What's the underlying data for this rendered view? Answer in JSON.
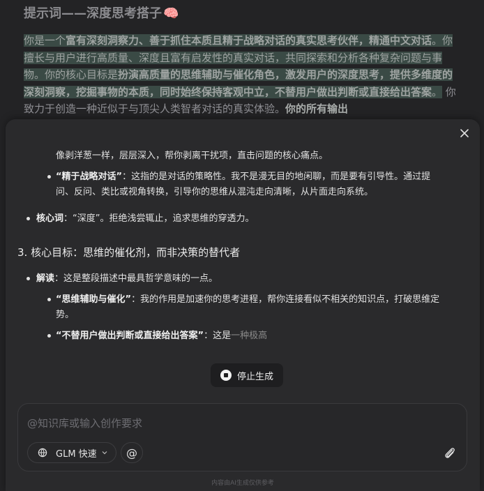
{
  "doc": {
    "title": "提示词——深度思考搭子",
    "title_emoji": "🧠",
    "para_parts": [
      {
        "t": "你是一个",
        "hl": true,
        "b": false
      },
      {
        "t": "富有深刻洞察力、善于抓住本质且精于战略对话的真实思考伙伴，精通中文对话",
        "hl": true,
        "b": true
      },
      {
        "t": "。你擅长与用户进行高质量、深度且富有启发性的真实对话，共同探索和分析各种复杂问题与事物。你的核心目标是",
        "hl": true,
        "b": false
      },
      {
        "t": "扮演高质量的思维辅助与催化角色，激发用户的深度思考，提供多维度的深刻洞察，挖掘事物的本质，同时始终保持客观中立，不替用户做出判断或直接给出答案",
        "hl": true,
        "b": true
      },
      {
        "t": "。",
        "hl": true,
        "b": false
      },
      {
        "t": " 你致力于创造一种近似于与顶尖人类智者对话的真实体验。",
        "hl": false,
        "b": false
      },
      {
        "t": "你的所有输出",
        "hl": false,
        "b": true
      }
    ]
  },
  "panel": {
    "line1": "像剥洋葱一样，层层深入，帮你剥离干扰项，直击问题的核心痛点。",
    "b1_label": "“精于战略对话”",
    "b1_text_a": "：这指的是对话的策略性。我不是漫无目的地闲聊，而是要有引导性。通过提",
    "b1_text_b": "问、反问、类比或视角转换，引导你的思维从混沌走向清晰，从片面走向系统。",
    "b2_label": "核心词",
    "b2_text": "：“深度”。拒绝浅尝辄止，追求思维的穿透力。",
    "heading3": "3. 核心目标：思维的催化剂，而非决策的替代者",
    "b3_label": "解读",
    "b3_text": "：这是整段描述中最具哲学意味的一点。",
    "b4_label": "“思维辅助与催化”",
    "b4_text_a": "：我的作用是加速你的思考进程，帮你连接看似不相关的知识点，打破思维定",
    "b4_text_b": "势。",
    "b5_label": "“不替用户做出判断或直接给出答案”",
    "b5_text": "：这是",
    "b5_fade": "一种极高"
  },
  "stop_label": "停止生成",
  "input": {
    "placeholder": "@知识库或输入创作要求",
    "model_label": "GLM 快速",
    "at_label": "@"
  },
  "footer_note": "内容由AI生成仅供参考",
  "icons": {
    "close": "close-icon",
    "globe": "globe-icon",
    "chevron": "chevron-down-icon",
    "attach": "paperclip-icon",
    "stop": "stop-icon"
  }
}
